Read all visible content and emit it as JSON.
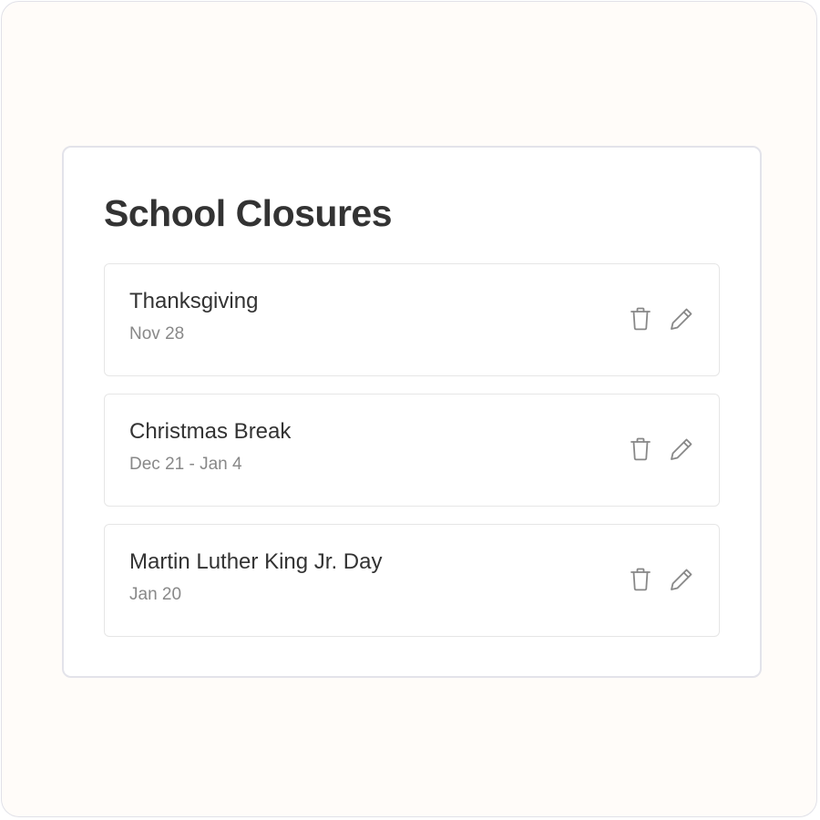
{
  "page": {
    "title": "School Closures"
  },
  "closures": [
    {
      "name": "Thanksgiving",
      "date": "Nov 28"
    },
    {
      "name": "Christmas Break",
      "date": "Dec 21 - Jan 4"
    },
    {
      "name": "Martin Luther King Jr. Day",
      "date": "Jan 20"
    }
  ],
  "icons": {
    "delete": "trash-icon",
    "edit": "pencil-icon"
  },
  "colors": {
    "background": "#fffcf9",
    "card": "#ffffff",
    "title_text": "#333333",
    "secondary_text": "#888888",
    "icon": "#888888",
    "border": "#e3e3ea"
  }
}
